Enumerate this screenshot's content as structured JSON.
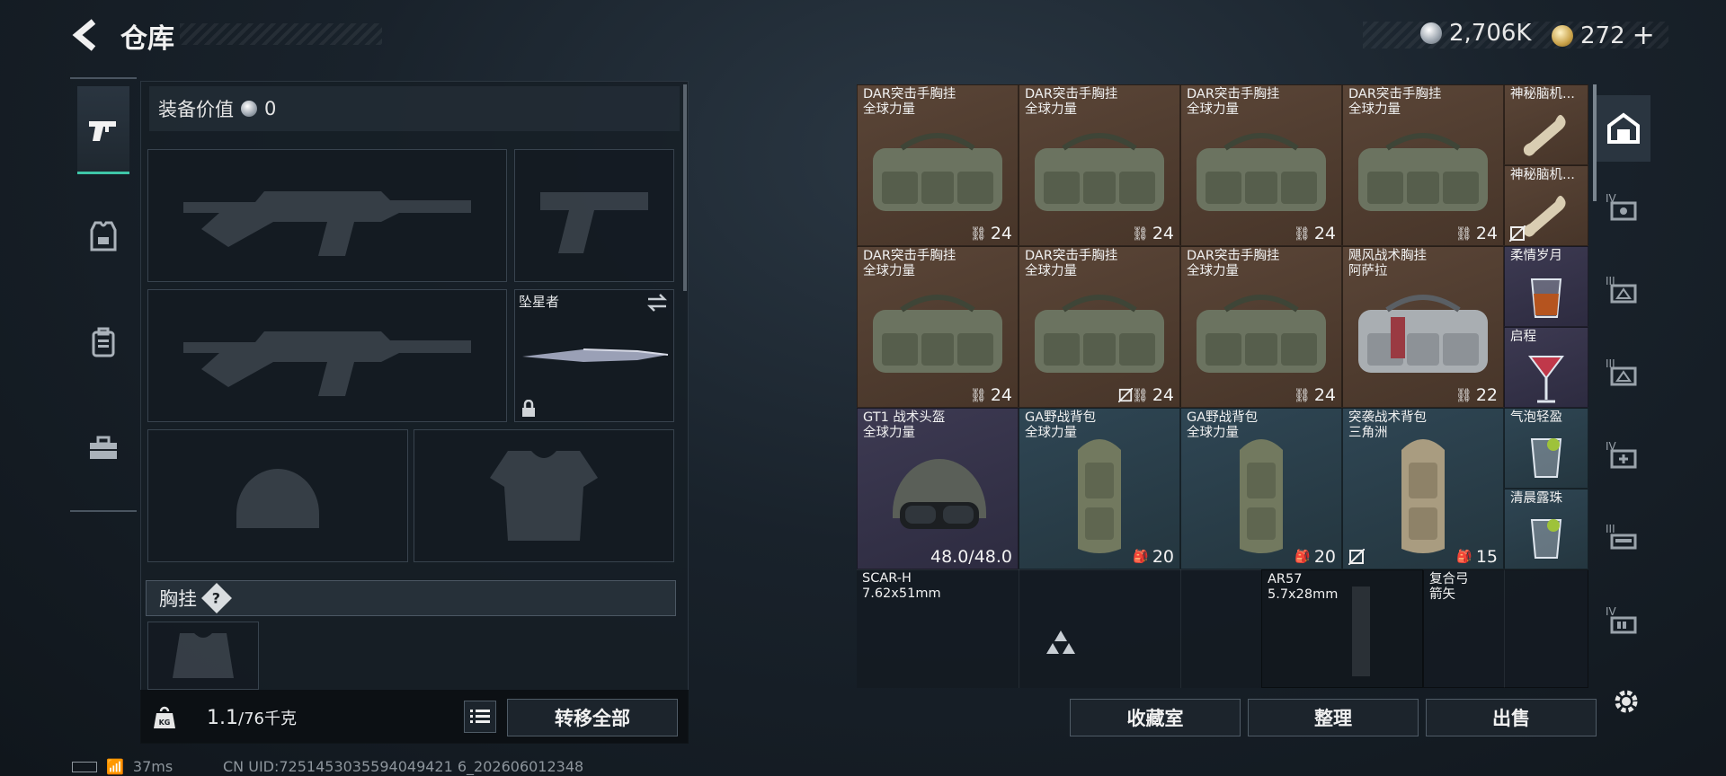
{
  "header": {
    "title": "仓库"
  },
  "currency": {
    "silver": "2,706K",
    "gold": "272",
    "gold_add": "+"
  },
  "loadout": {
    "equip_value_label": "装备价值",
    "equip_value": "0",
    "melee_name": "坠星者",
    "section_title": "胸挂",
    "section_badge": "?",
    "weight_current": "1.1",
    "weight_max": "/76千克",
    "transfer_all": "转移全部"
  },
  "inventory": {
    "rig1": {
      "name": "DAR突击手胸挂",
      "sub": "全球力量",
      "count": "24"
    },
    "rig2": {
      "name": "DAR突击手胸挂",
      "sub": "全球力量",
      "count": "24"
    },
    "rig3": {
      "name": "DAR突击手胸挂",
      "sub": "全球力量",
      "count": "24"
    },
    "rig4": {
      "name": "DAR突击手胸挂",
      "sub": "全球力量",
      "count": "24"
    },
    "rig5": {
      "name": "DAR突击手胸挂",
      "sub": "全球力量",
      "count": "24"
    },
    "rig6": {
      "name": "DAR突击手胸挂",
      "sub": "全球力量",
      "count": "24"
    },
    "rig7": {
      "name": "DAR突击手胸挂",
      "sub": "全球力量",
      "count": "24"
    },
    "rig8": {
      "name": "飓风战术胸挂",
      "sub": "阿萨拉",
      "count": "22"
    },
    "small1": {
      "name": "神秘脑机..."
    },
    "small2": {
      "name": "神秘脑机..."
    },
    "small3": {
      "name": "柔情岁月"
    },
    "small4": {
      "name": "启程"
    },
    "small5": {
      "name": "气泡轻盈"
    },
    "small6": {
      "name": "清晨露珠"
    },
    "helmet": {
      "name": "GT1 战术头盔",
      "sub": "全球力量",
      "count": "48.0/48.0"
    },
    "bag1": {
      "name": "GA野战背包",
      "sub": "全球力量",
      "count": "20"
    },
    "bag2": {
      "name": "GA野战背包",
      "sub": "全球力量",
      "count": "20"
    },
    "bag3": {
      "name": "突袭战术背包",
      "sub": "三角洲",
      "count": "15"
    },
    "gun1": {
      "name": "SCAR-H",
      "sub": "7.62x51mm"
    },
    "gun2": {
      "name": "AR57",
      "sub": "5.7x28mm"
    },
    "bow": {
      "name": "复合弓",
      "sub": "箭矢"
    }
  },
  "actions": {
    "collection": "收藏室",
    "sort": "整理",
    "sell": "出售"
  },
  "side_tabs": [
    "IV",
    "III",
    "III",
    "IV",
    "III",
    "IV"
  ],
  "status": {
    "ping": "37ms",
    "uid": "CN UID:7251453035594049421 6_202606012348"
  }
}
